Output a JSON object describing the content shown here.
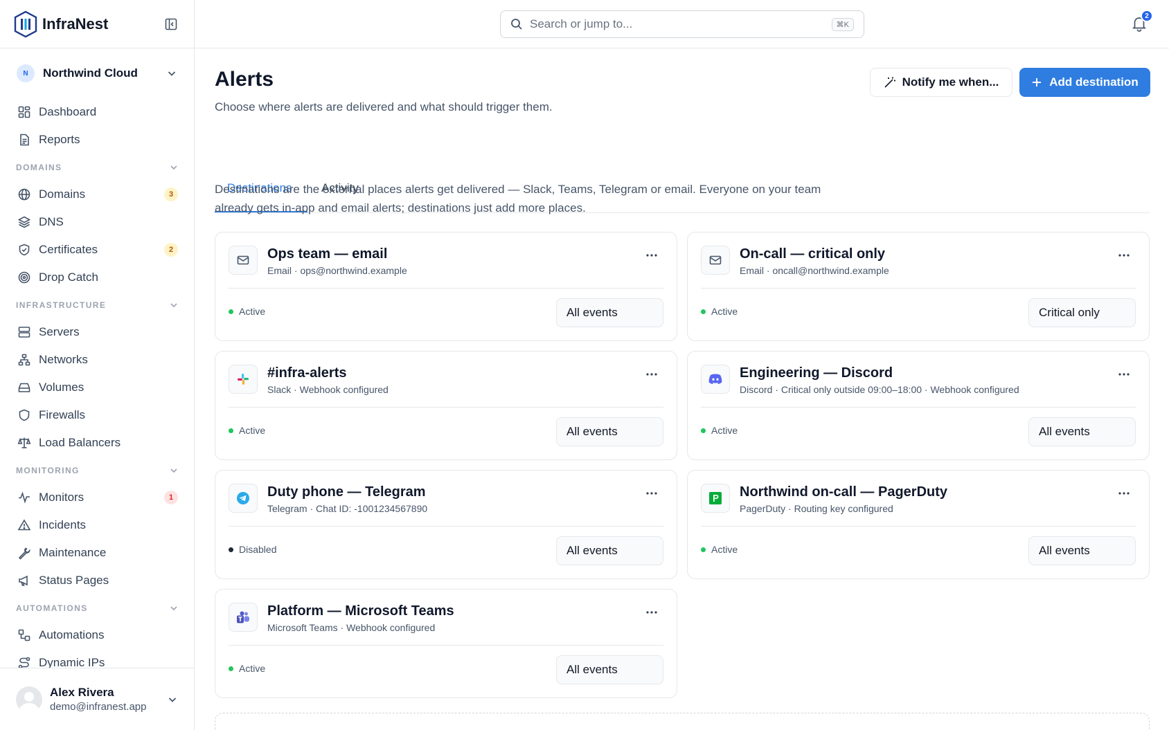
{
  "app": {
    "name": "InfraNest"
  },
  "org": {
    "initial": "N",
    "name": "Northwind Cloud"
  },
  "nav": {
    "top": [
      {
        "label": "Dashboard",
        "icon": "dashboard-icon"
      },
      {
        "label": "Reports",
        "icon": "report-icon"
      }
    ],
    "sections": {
      "domains": {
        "title": "DOMAINS",
        "items": [
          {
            "label": "Domains",
            "badge": "3"
          },
          {
            "label": "DNS"
          },
          {
            "label": "Certificates",
            "badge": "2"
          },
          {
            "label": "Drop Catch"
          }
        ]
      },
      "infrastructure": {
        "title": "INFRASTRUCTURE",
        "items": [
          {
            "label": "Servers"
          },
          {
            "label": "Networks"
          },
          {
            "label": "Volumes"
          },
          {
            "label": "Firewalls"
          },
          {
            "label": "Load Balancers"
          }
        ]
      },
      "monitoring": {
        "title": "MONITORING",
        "items": [
          {
            "label": "Monitors",
            "badge": "1"
          },
          {
            "label": "Incidents"
          },
          {
            "label": "Maintenance"
          },
          {
            "label": "Status Pages"
          }
        ]
      },
      "automations": {
        "title": "AUTOMATIONS",
        "items": [
          {
            "label": "Automations"
          },
          {
            "label": "Dynamic IPs"
          }
        ]
      }
    }
  },
  "user": {
    "name": "Alex Rivera",
    "email": "demo@infranest.app"
  },
  "topbar": {
    "search_placeholder": "Search or jump to...",
    "shortcut": "⌘K",
    "notifications": "2"
  },
  "page": {
    "title": "Alerts",
    "subtitle": "Choose where alerts are delivered and what should trigger them.",
    "notify_label": "Notify me when...",
    "add_label": "Add destination",
    "tabs": [
      "Destinations",
      "Activity"
    ],
    "intro_line1": "Destinations are the external places alerts get delivered — Slack, Teams, Telegram or email. Everyone on your team",
    "intro_line2": "already gets in-app and email alerts; destinations just add more places."
  },
  "destinations": [
    {
      "title": "Ops team — email",
      "sub": "Email · ops@northwind.example",
      "status": "Active",
      "trigger": "All events",
      "icon": "mail-icon"
    },
    {
      "title": "On-call — critical only",
      "sub": "Email · oncall@northwind.example",
      "status": "Active",
      "trigger": "Critical only",
      "icon": "mail-icon"
    },
    {
      "title": "#infra-alerts",
      "sub": "Slack · Webhook configured",
      "status": "Active",
      "trigger": "All events",
      "icon": "slack-icon"
    },
    {
      "title": "Engineering — Discord",
      "sub": "Discord · Critical only outside 09:00–18:00 · Webhook configured",
      "status": "Active",
      "trigger": "All events",
      "icon": "discord-icon"
    },
    {
      "title": "Duty phone — Telegram",
      "sub": "Telegram · Chat ID: -1001234567890",
      "status": "Disabled",
      "trigger": "All events",
      "icon": "telegram-icon"
    },
    {
      "title": "Northwind on-call — PagerDuty",
      "sub": "PagerDuty · Routing key configured",
      "status": "Active",
      "trigger": "All events",
      "icon": "pagerduty-icon"
    },
    {
      "title": "Platform — Microsoft Teams",
      "sub": "Microsoft Teams · Webhook configured",
      "status": "Active",
      "trigger": "All events",
      "icon": "teams-icon"
    }
  ],
  "colors": {
    "accent": "#2f7de1",
    "active": "#22c55e",
    "badge_amber": "#b45309",
    "badge_red": "#dc2626"
  }
}
